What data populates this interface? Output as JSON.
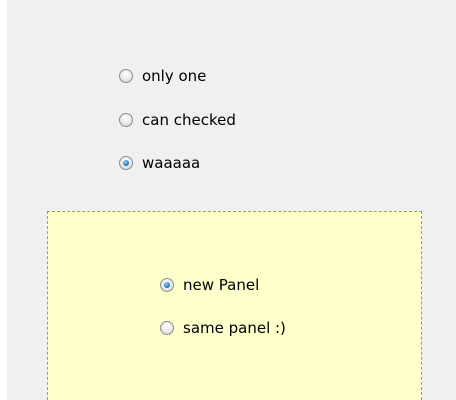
{
  "group_one": {
    "options": [
      {
        "label": "only one",
        "checked": false
      },
      {
        "label": "can checked",
        "checked": false
      },
      {
        "label": "waaaaa",
        "checked": true
      }
    ]
  },
  "panel": {
    "background_color": "#ffffcc",
    "options": [
      {
        "label": "new Panel",
        "checked": true
      },
      {
        "label": "same panel :)",
        "checked": false
      }
    ]
  }
}
